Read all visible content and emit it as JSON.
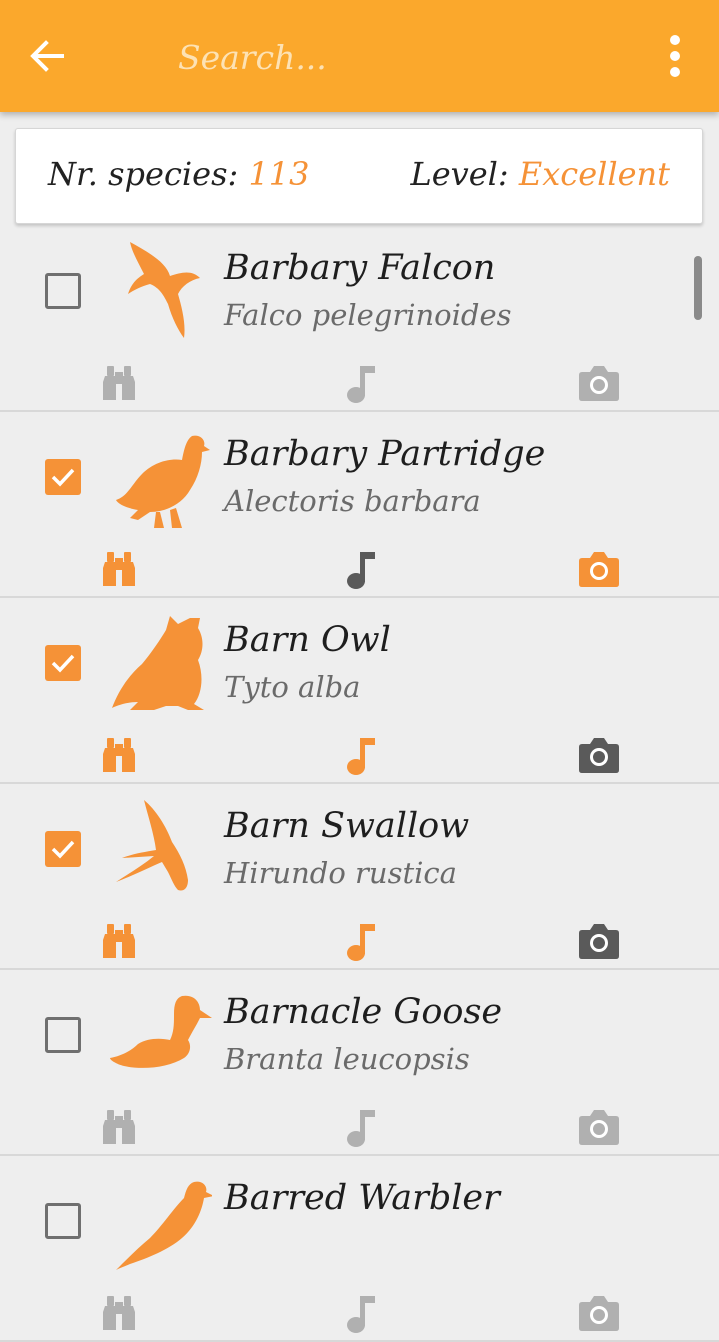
{
  "search": {
    "placeholder": "Search..."
  },
  "summary": {
    "species_label": "Nr. species:",
    "species_count": "113",
    "level_label": "Level:",
    "level_value": "Excellent"
  },
  "colors": {
    "accent": "#fba82c",
    "orange": "#f59237",
    "icon_inactive": "#b0b0b0",
    "icon_dark": "#5a5a5a"
  },
  "species": [
    {
      "name": "Barbary Falcon",
      "scientific": "Falco pelegrinoides",
      "checked": false,
      "silhouette": "falcon",
      "binoculars": "inactive",
      "sound": "inactive",
      "photo": "inactive"
    },
    {
      "name": "Barbary Partridge",
      "scientific": "Alectoris barbara",
      "checked": true,
      "silhouette": "partridge",
      "binoculars": "orange",
      "sound": "dark",
      "photo": "orange"
    },
    {
      "name": "Barn Owl",
      "scientific": "Tyto alba",
      "checked": true,
      "silhouette": "owl",
      "binoculars": "orange",
      "sound": "orange",
      "photo": "dark"
    },
    {
      "name": "Barn Swallow",
      "scientific": "Hirundo rustica",
      "checked": true,
      "silhouette": "swallow",
      "binoculars": "orange",
      "sound": "orange",
      "photo": "dark"
    },
    {
      "name": "Barnacle Goose",
      "scientific": "Branta leucopsis",
      "checked": false,
      "silhouette": "goose",
      "binoculars": "inactive",
      "sound": "inactive",
      "photo": "inactive"
    },
    {
      "name": "Barred Warbler",
      "scientific": "",
      "checked": false,
      "silhouette": "warbler",
      "binoculars": "inactive",
      "sound": "inactive",
      "photo": "inactive"
    }
  ]
}
